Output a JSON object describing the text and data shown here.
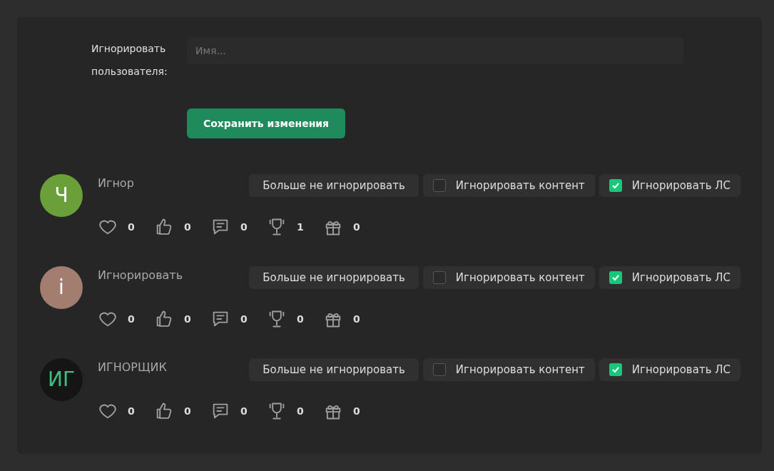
{
  "form": {
    "label": "Игнорировать пользователя:",
    "placeholder": "Имя...",
    "save_button": "Сохранить изменения"
  },
  "users": [
    {
      "avatar": {
        "initials": "Ч",
        "color": "#6a9f3a"
      },
      "initials_style": {
        "color": "#ffffff"
      },
      "name": "Игнор",
      "unignore": "Больше не игнорировать",
      "ignore_content": {
        "label": "Игнорировать контент",
        "checked": false
      },
      "ignore_pm": {
        "label": "Игнорировать ЛС",
        "checked": true
      },
      "stats": [
        {
          "kind": "heart",
          "value": "0"
        },
        {
          "kind": "like",
          "value": "0"
        },
        {
          "kind": "comment",
          "value": "0"
        },
        {
          "kind": "trophy",
          "value": "1"
        },
        {
          "kind": "gift",
          "value": "0"
        }
      ]
    },
    {
      "avatar": {
        "initials": "i",
        "color": "#a27d70"
      },
      "initials_style": {
        "color": "#ffffff"
      },
      "name": "Игнорировать",
      "unignore": "Больше не игнорировать",
      "ignore_content": {
        "label": "Игнорировать контент",
        "checked": false
      },
      "ignore_pm": {
        "label": "Игнорировать ЛС",
        "checked": true
      },
      "stats": [
        {
          "kind": "heart",
          "value": "0"
        },
        {
          "kind": "like",
          "value": "0"
        },
        {
          "kind": "comment",
          "value": "0"
        },
        {
          "kind": "trophy",
          "value": "0"
        },
        {
          "kind": "gift",
          "value": "0"
        }
      ]
    },
    {
      "avatar": {
        "initials": "ИГ",
        "color": "#151515"
      },
      "initials_style": {
        "color": "#3fbf7f"
      },
      "name": "ИГНОРЩИК",
      "unignore": "Больше не игнорировать",
      "ignore_content": {
        "label": "Игнорировать контент",
        "checked": false
      },
      "ignore_pm": {
        "label": "Игнорировать ЛС",
        "checked": true
      },
      "stats": [
        {
          "kind": "heart",
          "value": "0"
        },
        {
          "kind": "like",
          "value": "0"
        },
        {
          "kind": "comment",
          "value": "0"
        },
        {
          "kind": "trophy",
          "value": "0"
        },
        {
          "kind": "gift",
          "value": "0"
        }
      ]
    }
  ]
}
